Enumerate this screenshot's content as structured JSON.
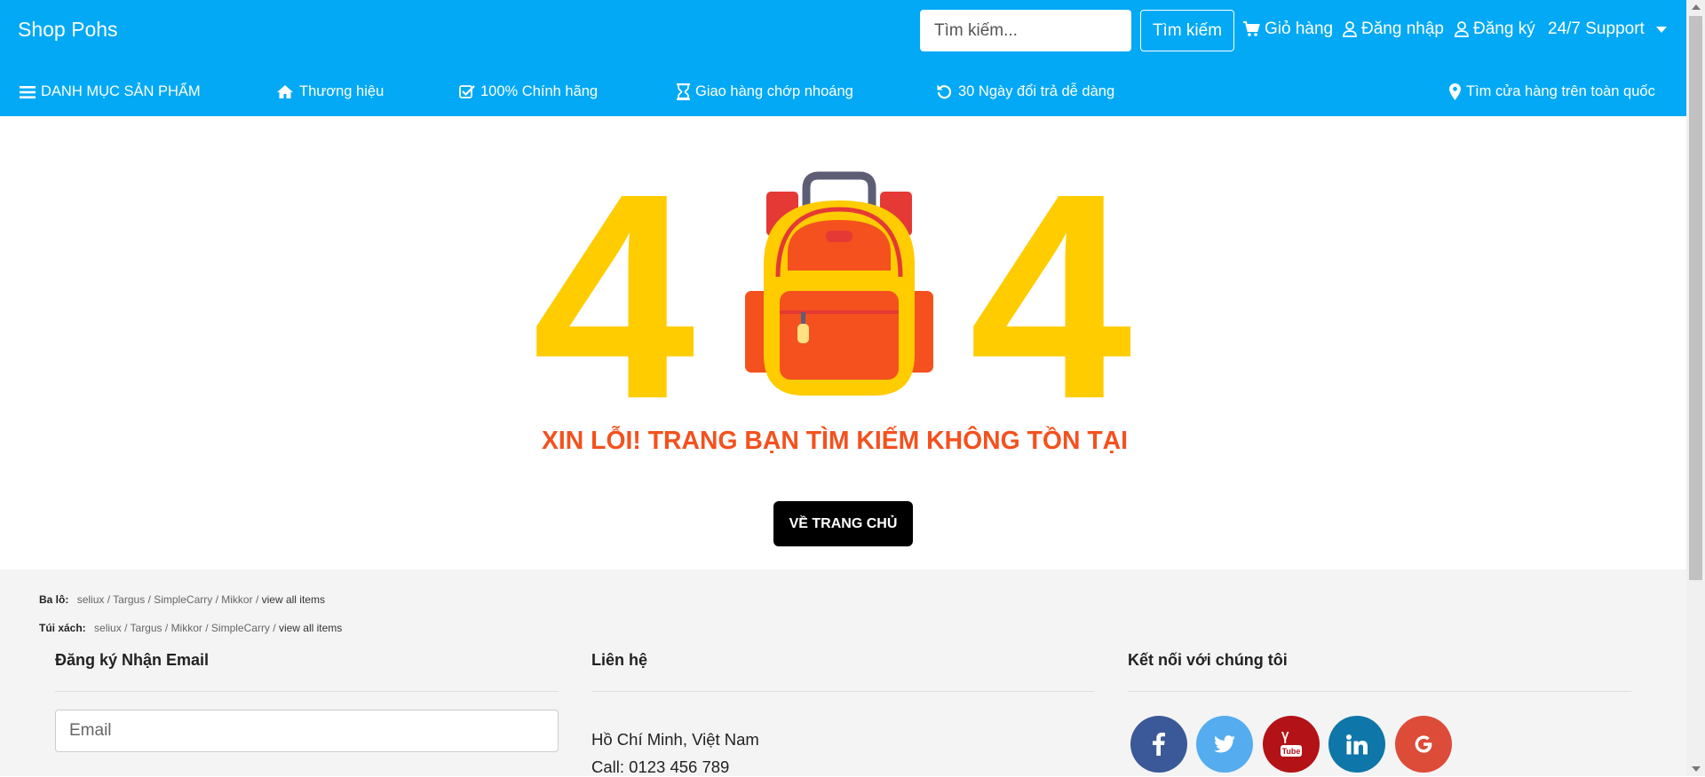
{
  "header": {
    "brand": "Shop Pohs",
    "search": {
      "placeholder": "Tìm kiếm...",
      "button": "Tìm kiếm"
    },
    "links": {
      "cart": "Giỏ hàng",
      "login": "Đăng nhập",
      "register": "Đăng ký",
      "support": "24/7 Support"
    }
  },
  "subnav": {
    "categories": "DANH MỤC SẢN PHẨM",
    "brands": "Thương hiệu",
    "genuine": "100% Chính hãng",
    "delivery": "Giao hàng chớp nhoáng",
    "returns": "30 Ngày đổi trả dễ dàng",
    "stores": "Tìm cửa hàng trên toàn quốc"
  },
  "error": {
    "code_left": "4",
    "code_right": "4",
    "message": "XIN LỖI! TRANG BẠN TÌM KIẾM KHÔNG TỒN TẠI",
    "home_button": "VỀ TRANG CHỦ"
  },
  "footer": {
    "quick_links": [
      {
        "label": "Ba lô:",
        "items": [
          "seliux",
          "Targus",
          "SimpleCarry",
          "Mikkor"
        ],
        "all": "view all items"
      },
      {
        "label": "Túi xách:",
        "items": [
          "seliux",
          "Targus",
          "Mikkor",
          "SimpleCarry"
        ],
        "all": "view all items"
      }
    ],
    "newsletter": {
      "title": "Đăng ký Nhận Email",
      "placeholder": "Email"
    },
    "contact": {
      "title": "Liên hệ",
      "address": "Hồ Chí Minh, Việt Nam",
      "phone": "Call: 0123 456 789"
    },
    "social": {
      "title": "Kết nối với chúng tôi",
      "networks": [
        "facebook",
        "twitter",
        "youtube",
        "linkedin",
        "google"
      ]
    }
  },
  "colors": {
    "header_bg": "#03a9f4",
    "yellow": "#ffcc00",
    "orange": "#f4511e",
    "facebook": "#3b5998",
    "twitter": "#55acee",
    "youtube": "#b31217",
    "linkedin": "#0e76a8",
    "google": "#dd4b39"
  }
}
